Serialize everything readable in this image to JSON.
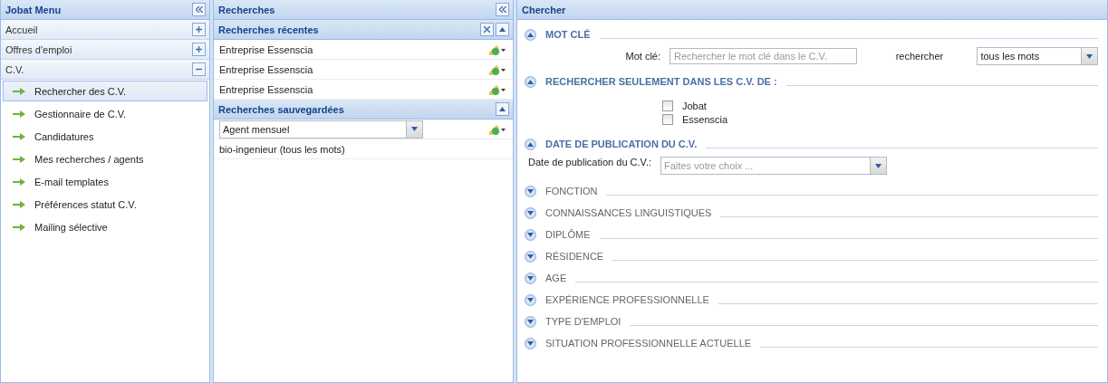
{
  "menu": {
    "title": "Jobat Menu",
    "sections": [
      {
        "label": "Accueil",
        "expanded": false
      },
      {
        "label": "Offres d'emploi",
        "expanded": false
      },
      {
        "label": "C.V.",
        "expanded": true,
        "items": [
          {
            "label": "Rechercher des C.V.",
            "selected": true
          },
          {
            "label": "Gestionnaire de C.V.",
            "selected": false
          },
          {
            "label": "Candidatures",
            "selected": false
          },
          {
            "label": "Mes recherches / agents",
            "selected": false
          },
          {
            "label": "E-mail templates",
            "selected": false
          },
          {
            "label": "Préférences statut C.V.",
            "selected": false
          },
          {
            "label": "Mailing sélective",
            "selected": false
          }
        ]
      }
    ]
  },
  "searches": {
    "title": "Recherches",
    "recent": {
      "title": "Recherches récentes",
      "rows": [
        "Entreprise Essenscia",
        "Entreprise Essenscia",
        "Entreprise Essenscia"
      ]
    },
    "saved": {
      "title": "Recherches sauvegardées",
      "select_value": "Agent mensuel",
      "rows": [
        "bio-ingenieur (tous les mots)"
      ]
    }
  },
  "search": {
    "title": "Chercher",
    "sections": [
      {
        "kind": "keyword",
        "title": "MOT CLÉ",
        "expanded": true,
        "label": "Mot clé:",
        "placeholder": "Rechercher le mot clé dans le C.V.",
        "mode_label": "rechercher",
        "mode_value": "tous les mots"
      },
      {
        "kind": "checks",
        "title": "RECHERCHER SEULEMENT DANS LES C.V. DE :",
        "expanded": true,
        "options": [
          {
            "label": "Jobat",
            "checked": false
          },
          {
            "label": "Essenscia",
            "checked": false
          }
        ]
      },
      {
        "kind": "date",
        "title": "DATE DE PUBLICATION DU C.V.",
        "expanded": true,
        "label": "Date de publication du C.V.:",
        "placeholder": "Faites votre choix ..."
      },
      {
        "title": "FONCTION",
        "expanded": false
      },
      {
        "title": "CONNAISSANCES LINGUISTIQUES",
        "expanded": false
      },
      {
        "title": "DIPLÔME",
        "expanded": false
      },
      {
        "title": "RÉSIDENCE",
        "expanded": false
      },
      {
        "title": "AGE",
        "expanded": false
      },
      {
        "title": "EXPÉRIENCE PROFESSIONNELLE",
        "expanded": false
      },
      {
        "title": "TYPE D'EMPLOI",
        "expanded": false
      },
      {
        "title": "SITUATION PROFESSIONNELLE ACTUELLE",
        "expanded": false
      }
    ]
  }
}
